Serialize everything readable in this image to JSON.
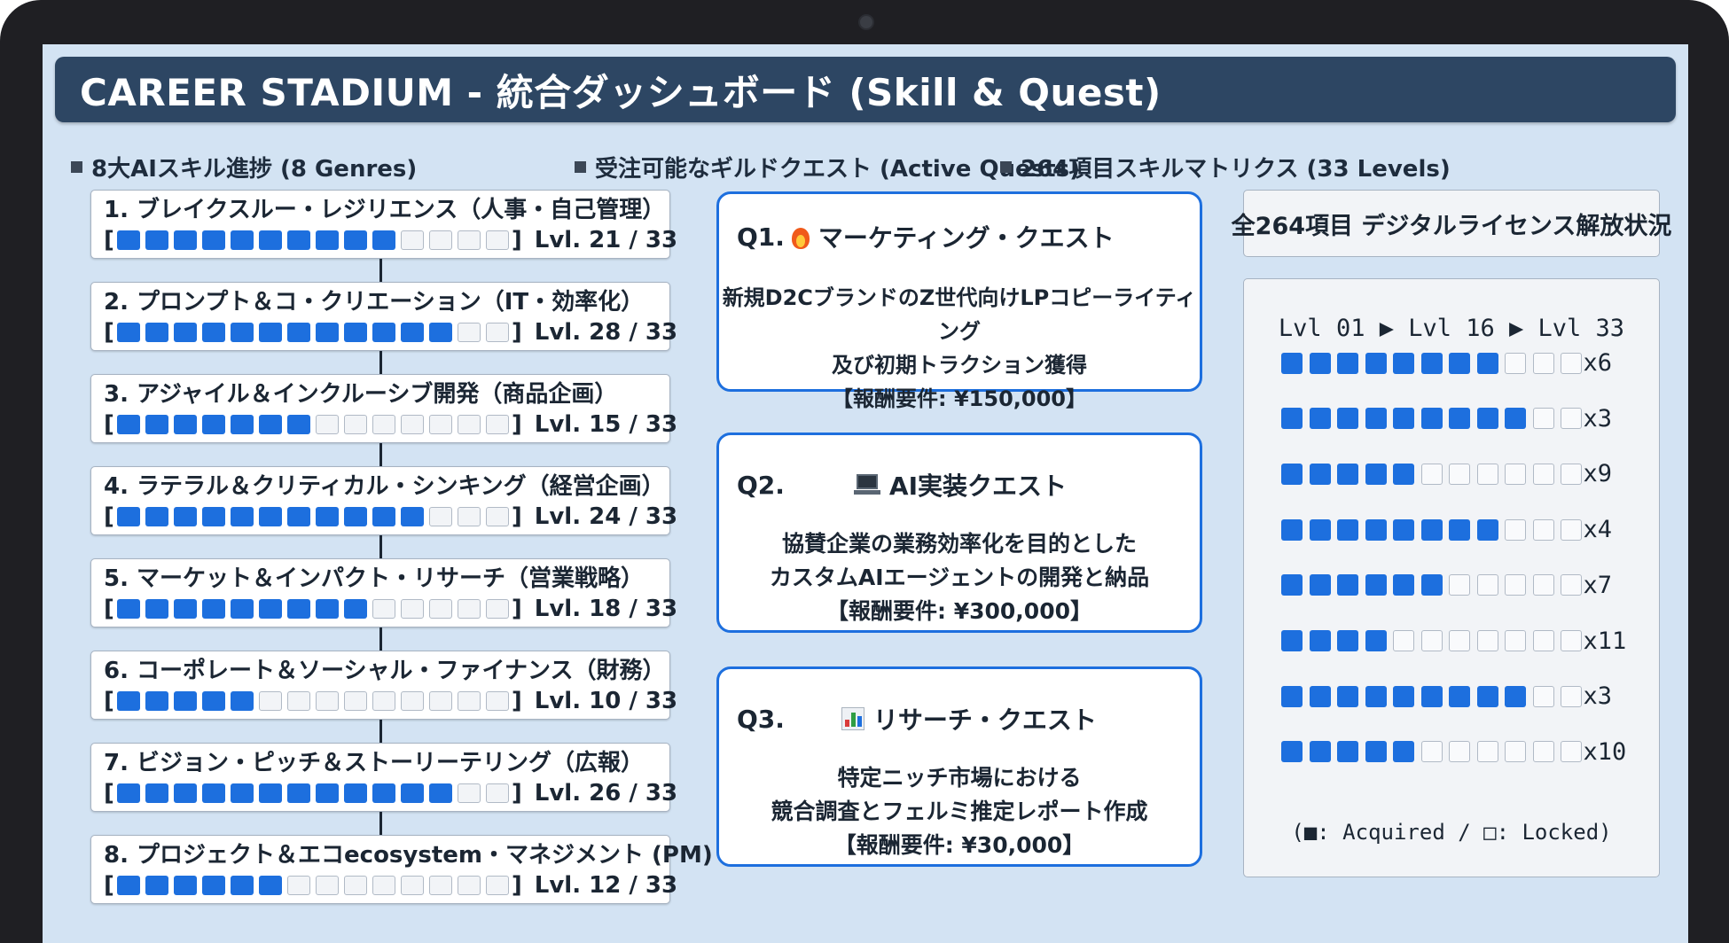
{
  "header": {
    "title": "CAREER STADIUM - 統合ダッシュボード (Skill & Quest)"
  },
  "skills_section": {
    "title": "8大AIスキル進捗 (8 Genres)",
    "total_cells": 14,
    "items": [
      {
        "name": "1. ブレイクスルー・レジリエンス（人事・自己管理）",
        "filled": 10,
        "level_text": "Lvl. 21 / 33"
      },
      {
        "name": "2. プロンプト＆コ・クリエーション（IT・効率化）",
        "filled": 12,
        "level_text": "Lvl. 28 / 33"
      },
      {
        "name": "3. アジャイル＆インクルーシブ開発（商品企画）",
        "filled": 7,
        "level_text": "Lvl. 15 / 33"
      },
      {
        "name": "4. ラテラル＆クリティカル・シンキング（経営企画）",
        "filled": 11,
        "level_text": "Lvl. 24 / 33"
      },
      {
        "name": "5. マーケット＆インパクト・リサーチ（営業戦略）",
        "filled": 9,
        "level_text": "Lvl. 18 / 33"
      },
      {
        "name": "6. コーポレート＆ソーシャル・ファイナンス（財務）",
        "filled": 5,
        "level_text": "Lvl. 10 / 33"
      },
      {
        "name": "7. ビジョン・ピッチ＆ストーリーテリング（広報）",
        "filled": 12,
        "level_text": "Lvl. 26 / 33"
      },
      {
        "name": "8. プロジェクト＆エコecosystem・マネジメント (PM)",
        "filled": 6,
        "level_text": "Lvl. 12 / 33"
      }
    ]
  },
  "quests_section": {
    "title": "受注可能なギルドクエスト (Active Quests)",
    "quests": [
      {
        "label": "Q1.",
        "icon": "fire-icon",
        "title": "マーケティング・クエスト",
        "lines": [
          "新規D2CブランドのZ世代向けLPコピーライティング",
          "及び初期トラクション獲得"
        ],
        "reward": "【報酬要件: ¥150,000】"
      },
      {
        "label": "Q2.",
        "icon": "laptop-icon",
        "title": "AI実装クエスト",
        "lines": [
          "協賛企業の業務効率化を目的とした",
          "カスタムAIエージェントの開発と納品"
        ],
        "reward": "【報酬要件: ¥300,000】"
      },
      {
        "label": "Q3.",
        "icon": "bar-chart-icon",
        "title": "リサーチ・クエスト",
        "lines": [
          "特定ニッチ市場における",
          "競合調査とフェルミ推定レポート作成"
        ],
        "reward": "【報酬要件: ¥30,000】"
      }
    ]
  },
  "matrix_section": {
    "title": "264項目スキルマトリクス (33 Levels)",
    "license_label": "全264項目 デジタルライセンス解放状況",
    "range_label": "Lvl 01 ▶ Lvl 16 ▶ Lvl 33",
    "total_cells": 11,
    "rows": [
      {
        "filled": 8,
        "multiplier": "x6"
      },
      {
        "filled": 9,
        "multiplier": "x3"
      },
      {
        "filled": 5,
        "multiplier": "x9"
      },
      {
        "filled": 8,
        "multiplier": "x4"
      },
      {
        "filled": 6,
        "multiplier": "x7"
      },
      {
        "filled": 4,
        "multiplier": "x11"
      },
      {
        "filled": 9,
        "multiplier": "x3"
      },
      {
        "filled": 5,
        "multiplier": "x10"
      }
    ],
    "legend": "(■: Acquired / □: Locked)"
  },
  "colors": {
    "accent": "#1d6fde",
    "header_bg": "#2d4663",
    "screen_bg": "#d3e3f3"
  }
}
